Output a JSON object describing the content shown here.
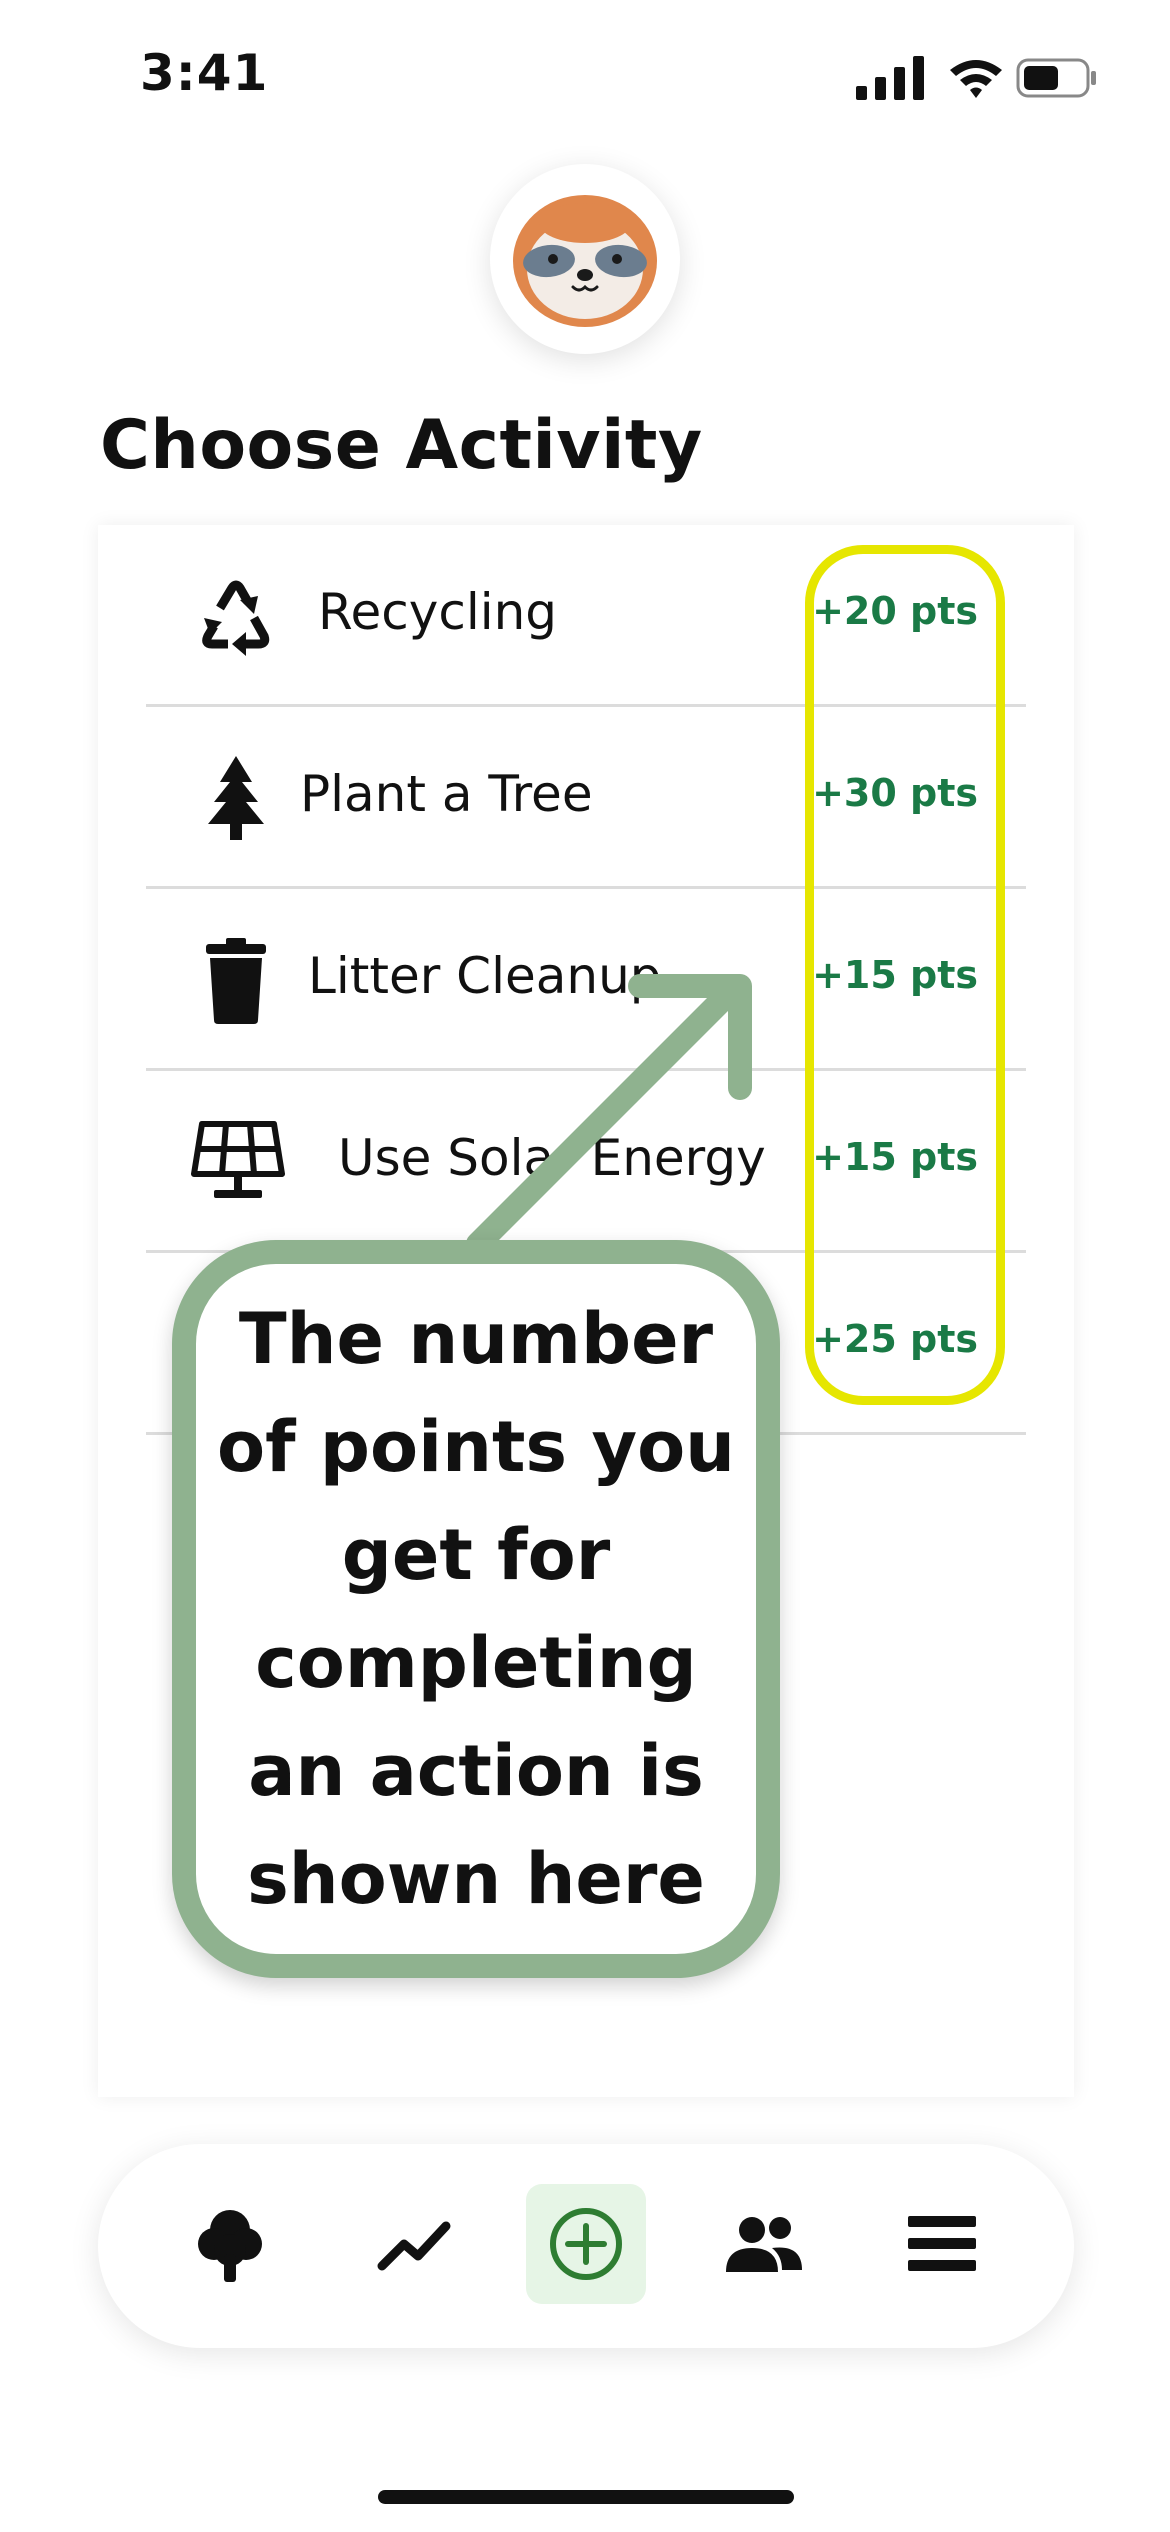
{
  "status_bar": {
    "time": "3:41"
  },
  "page": {
    "title": "Choose Activity"
  },
  "activities": [
    {
      "label": "Recycling",
      "points": "+20 pts",
      "icon": "recycle-icon"
    },
    {
      "label": "Plant a Tree",
      "points": "+30 pts",
      "icon": "tree-icon"
    },
    {
      "label": "Litter Cleanup",
      "points": "+15 pts",
      "icon": "trash-icon"
    },
    {
      "label": "Use Solar Energy",
      "points": "+15 pts",
      "icon": "solar-panel-icon"
    },
    {
      "label": "",
      "points": "+25 pts",
      "icon": "bicycle-icon"
    }
  ],
  "annotation": {
    "text": "The number of points you get for completing an action is shown here",
    "highlight_color": "#e6e600",
    "callout_color": "#8fb28f"
  },
  "nav": {
    "items": [
      "tree-icon",
      "trend-icon",
      "add-circle-icon",
      "group-icon",
      "menu-icon"
    ],
    "active_index": 2,
    "active_color": "#2e7d32"
  },
  "colors": {
    "points": "#1a7a46",
    "avatar": "#e0874c"
  }
}
